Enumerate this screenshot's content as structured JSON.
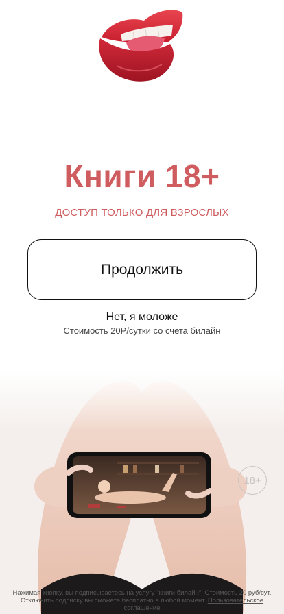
{
  "app": {
    "title": "Книги 18+",
    "subtitle": "ДОСТУП ТОЛЬКО ДЛЯ ВЗРОСЛЫХ"
  },
  "actions": {
    "continue_label": "Продолжить",
    "younger_label": "Нет, я моложе"
  },
  "pricing": {
    "cost_text": "Стоимость 20Р/сутки со счета билайн"
  },
  "badge": {
    "age_label": "18+"
  },
  "legal": {
    "line1": "Нажимая кнопку, вы подписываетесь на услугу \"книги билайн\". Стоимость 20 руб/сут.",
    "line2": "Отключить подписку вы сможете бесплатно в любой момент.",
    "agreement_link": "Пользовательское соглашение"
  },
  "colors": {
    "accent": "#cf5d5f",
    "button_border": "#111111",
    "badge": "#c9c4c2"
  },
  "icons": {
    "logo": "lips-logo-icon",
    "phone": "phone-photo-icon"
  }
}
